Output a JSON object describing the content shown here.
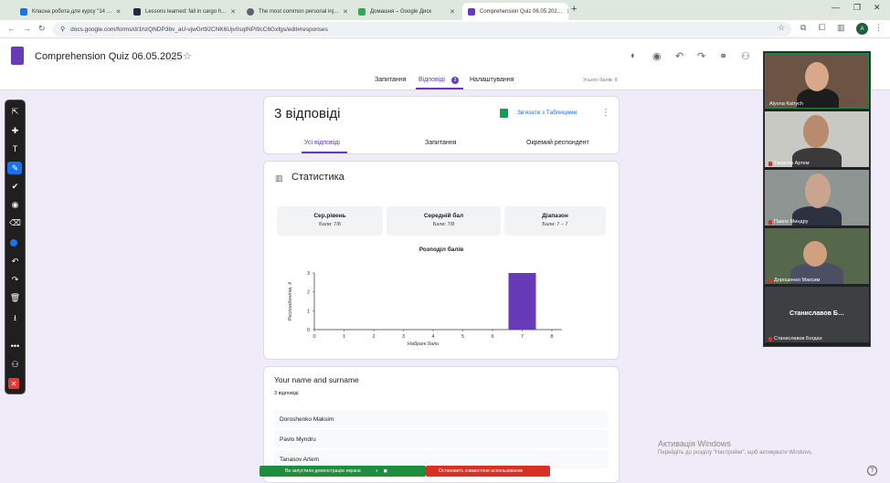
{
  "browser": {
    "tabs": [
      {
        "title": "Класна робота для курсу \"14 …",
        "favicon_color": "#1a73e8"
      },
      {
        "title": "Lessons learned: fall in cargo h…",
        "favicon_color": "#1f2a44"
      },
      {
        "title": "The most common personal inj…",
        "favicon_color": "#5f6368"
      },
      {
        "title": "Домашня – Google Диск",
        "favicon_color": "#34a853"
      },
      {
        "title": "Comprehension Quiz 06.05.202…",
        "favicon_color": "#673ab7"
      }
    ],
    "new_tab": "+",
    "url": "docs.google.com/forms/d/1hzQNDP3bv_aU-vjwGrt92CNK6Ujv0sqINPI9cC6Gxfgs/edit#responses",
    "profile_initial": "A"
  },
  "form": {
    "title": "Comprehension Quiz 06.05.2025",
    "nav_tabs": {
      "questions": "Запитання",
      "answers": "Відповіді",
      "answers_badge": "3",
      "settings": "Налаштування"
    },
    "total_points": "Усього балів: 8"
  },
  "responses": {
    "count_title": "3 відповіді",
    "link_sheets": "Зв'язати з Таблицями",
    "subtabs": {
      "summary": "Усі відповіді",
      "questions": "Запитання",
      "individual": "Окремий респондент"
    }
  },
  "stats": {
    "title": "Статистика",
    "boxes": [
      {
        "label": "Сер.рівень",
        "value": "Бали: 7/8"
      },
      {
        "label": "Середній бал",
        "value": "Бали: 7/8"
      },
      {
        "label": "Діапазон",
        "value": "Бали: 7 – 7"
      }
    ]
  },
  "chart_data": {
    "type": "bar",
    "title": "Розподіл балів",
    "xlabel": "Набрані бали",
    "ylabel": "Респондентів, #",
    "x": [
      0,
      1,
      2,
      3,
      4,
      5,
      6,
      7,
      8
    ],
    "values": [
      0,
      0,
      0,
      0,
      0,
      0,
      0,
      3,
      0
    ],
    "yticks": [
      0,
      1,
      2,
      3
    ],
    "ylim": [
      0,
      3
    ],
    "bar_color": "#673ab7",
    "grid": false
  },
  "question1": {
    "title": "Your name and surname",
    "count": "3 відповіді",
    "answers": [
      "Doroshenko Maksim",
      "Pavlo Myndru",
      "Tanasov Artem"
    ]
  },
  "participants": [
    {
      "name": "Alyona Katrych",
      "muted": false
    },
    {
      "name": "Танасов Артем",
      "muted": true
    },
    {
      "name": "Павло Миндру",
      "muted": true
    },
    {
      "name": "Дорошенко Максим",
      "muted": true
    },
    {
      "name": "Станиславов Богдан",
      "muted": true
    }
  ],
  "big_name": "Станиславов Б…",
  "share": {
    "notice": "Ви запустили демонстрацію екрана",
    "stop": "Остановить совместное использование"
  },
  "watermark": {
    "line1": "Активація Windows",
    "line2": "Перейдіть до розділу \"Настройки\", щоб активувати Windows."
  },
  "help": "?"
}
